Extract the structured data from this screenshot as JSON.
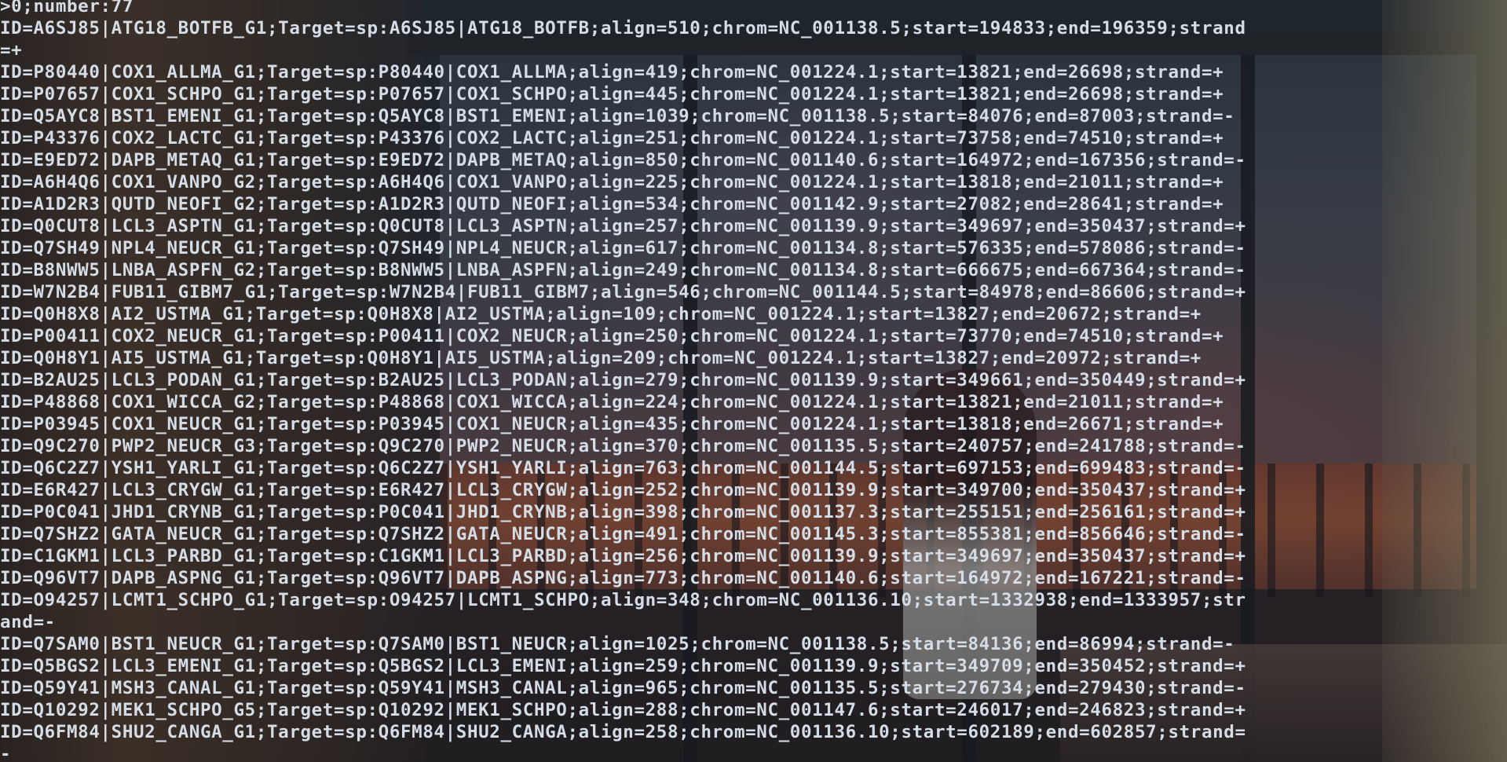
{
  "terminal": {
    "lines": [
      ">0;number:77",
      "ID=A6SJ85|ATG18_BOTFB_G1;Target=sp:A6SJ85|ATG18_BOTFB;align=510;chrom=NC_001138.5;start=194833;end=196359;strand",
      "=+",
      "ID=P80440|COX1_ALLMA_G1;Target=sp:P80440|COX1_ALLMA;align=419;chrom=NC_001224.1;start=13821;end=26698;strand=+",
      "ID=P07657|COX1_SCHPO_G1;Target=sp:P07657|COX1_SCHPO;align=445;chrom=NC_001224.1;start=13821;end=26698;strand=+",
      "ID=Q5AYC8|BST1_EMENI_G1;Target=sp:Q5AYC8|BST1_EMENI;align=1039;chrom=NC_001138.5;start=84076;end=87003;strand=-",
      "ID=P43376|COX2_LACTC_G1;Target=sp:P43376|COX2_LACTC;align=251;chrom=NC_001224.1;start=73758;end=74510;strand=+",
      "ID=E9ED72|DAPB_METAQ_G1;Target=sp:E9ED72|DAPB_METAQ;align=850;chrom=NC_001140.6;start=164972;end=167356;strand=-",
      "ID=A6H4Q6|COX1_VANPO_G2;Target=sp:A6H4Q6|COX1_VANPO;align=225;chrom=NC_001224.1;start=13818;end=21011;strand=+",
      "ID=A1D2R3|QUTD_NEOFI_G2;Target=sp:A1D2R3|QUTD_NEOFI;align=534;chrom=NC_001142.9;start=27082;end=28641;strand=+",
      "ID=Q0CUT8|LCL3_ASPTN_G1;Target=sp:Q0CUT8|LCL3_ASPTN;align=257;chrom=NC_001139.9;start=349697;end=350437;strand=+",
      "ID=Q7SH49|NPL4_NEUCR_G1;Target=sp:Q7SH49|NPL4_NEUCR;align=617;chrom=NC_001134.8;start=576335;end=578086;strand=-",
      "ID=B8NWW5|LNBA_ASPFN_G2;Target=sp:B8NWW5|LNBA_ASPFN;align=249;chrom=NC_001134.8;start=666675;end=667364;strand=-",
      "ID=W7N2B4|FUB11_GIBM7_G1;Target=sp:W7N2B4|FUB11_GIBM7;align=546;chrom=NC_001144.5;start=84978;end=86606;strand=+",
      "ID=Q0H8X8|AI2_USTMA_G1;Target=sp:Q0H8X8|AI2_USTMA;align=109;chrom=NC_001224.1;start=13827;end=20672;strand=+",
      "ID=P00411|COX2_NEUCR_G1;Target=sp:P00411|COX2_NEUCR;align=250;chrom=NC_001224.1;start=73770;end=74510;strand=+",
      "ID=Q0H8Y1|AI5_USTMA_G1;Target=sp:Q0H8Y1|AI5_USTMA;align=209;chrom=NC_001224.1;start=13827;end=20972;strand=+",
      "ID=B2AU25|LCL3_PODAN_G1;Target=sp:B2AU25|LCL3_PODAN;align=279;chrom=NC_001139.9;start=349661;end=350449;strand=+",
      "ID=P48868|COX1_WICCA_G2;Target=sp:P48868|COX1_WICCA;align=224;chrom=NC_001224.1;start=13821;end=21011;strand=+",
      "ID=P03945|COX1_NEUCR_G1;Target=sp:P03945|COX1_NEUCR;align=435;chrom=NC_001224.1;start=13818;end=26671;strand=+",
      "ID=Q9C270|PWP2_NEUCR_G3;Target=sp:Q9C270|PWP2_NEUCR;align=370;chrom=NC_001135.5;start=240757;end=241788;strand=-",
      "ID=Q6C2Z7|YSH1_YARLI_G1;Target=sp:Q6C2Z7|YSH1_YARLI;align=763;chrom=NC_001144.5;start=697153;end=699483;strand=-",
      "ID=E6R427|LCL3_CRYGW_G1;Target=sp:E6R427|LCL3_CRYGW;align=252;chrom=NC_001139.9;start=349700;end=350437;strand=+",
      "ID=P0C041|JHD1_CRYNB_G1;Target=sp:P0C041|JHD1_CRYNB;align=398;chrom=NC_001137.3;start=255151;end=256161;strand=+",
      "ID=Q7SHZ2|GATA_NEUCR_G1;Target=sp:Q7SHZ2|GATA_NEUCR;align=491;chrom=NC_001145.3;start=855381;end=856646;strand=-",
      "ID=C1GKM1|LCL3_PARBD_G1;Target=sp:C1GKM1|LCL3_PARBD;align=256;chrom=NC_001139.9;start=349697;end=350437;strand=+",
      "ID=Q96VT7|DAPB_ASPNG_G1;Target=sp:Q96VT7|DAPB_ASPNG;align=773;chrom=NC_001140.6;start=164972;end=167221;strand=-",
      "ID=O94257|LCMT1_SCHPO_G1;Target=sp:O94257|LCMT1_SCHPO;align=348;chrom=NC_001136.10;start=1332938;end=1333957;str",
      "and=-",
      "ID=Q7SAM0|BST1_NEUCR_G1;Target=sp:Q7SAM0|BST1_NEUCR;align=1025;chrom=NC_001138.5;start=84136;end=86994;strand=-",
      "ID=Q5BGS2|LCL3_EMENI_G1;Target=sp:Q5BGS2|LCL3_EMENI;align=259;chrom=NC_001139.9;start=349709;end=350452;strand=+",
      "ID=Q59Y41|MSH3_CANAL_G1;Target=sp:Q59Y41|MSH3_CANAL;align=965;chrom=NC_001135.5;start=276734;end=279430;strand=-",
      "ID=Q10292|MEK1_SCHPO_G5;Target=sp:Q10292|MEK1_SCHPO;align=288;chrom=NC_001147.6;start=246017;end=246823;strand=+",
      "ID=Q6FM84|SHU2_CANGA_G1;Target=sp:Q6FM84|SHU2_CANGA;align=258;chrom=NC_001136.10;start=602189;end=602857;strand=",
      "-"
    ]
  }
}
